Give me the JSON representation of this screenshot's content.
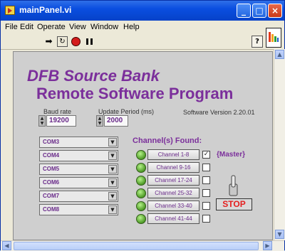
{
  "window": {
    "title": "mainPanel.vi"
  },
  "menubar": [
    "File",
    "Edit",
    "Operate",
    "View",
    "Window",
    "Help"
  ],
  "toolbar": {
    "help_label": "?"
  },
  "panel": {
    "title_line1": "DFB Source Bank",
    "title_line2": "Remote Software Program",
    "baud_rate_label": "Baud rate",
    "baud_rate_value": "19200",
    "update_period_label": "Update Period (ms)",
    "update_period_value": "2000",
    "software_version": "Software Version 2.20.01",
    "com_ports": [
      "COM3",
      "COM4",
      "COM5",
      "COM6",
      "COM7",
      "COM8"
    ],
    "channels_found_label": "Channel(s) Found:",
    "channels": [
      {
        "label": "Channel 1-8",
        "checked": true
      },
      {
        "label": "Channel 9-16",
        "checked": false
      },
      {
        "label": "Channel 17-24",
        "checked": false
      },
      {
        "label": "Channel 25-32",
        "checked": false
      },
      {
        "label": "Channel 33-40",
        "checked": false
      },
      {
        "label": "Channel 41-44",
        "checked": false
      }
    ],
    "master_label": "{Master}",
    "stop_label": "STOP"
  },
  "colors": {
    "accent": "#7b2f9b",
    "stop": "#e52020",
    "titlebar": "#0a4ee0"
  }
}
